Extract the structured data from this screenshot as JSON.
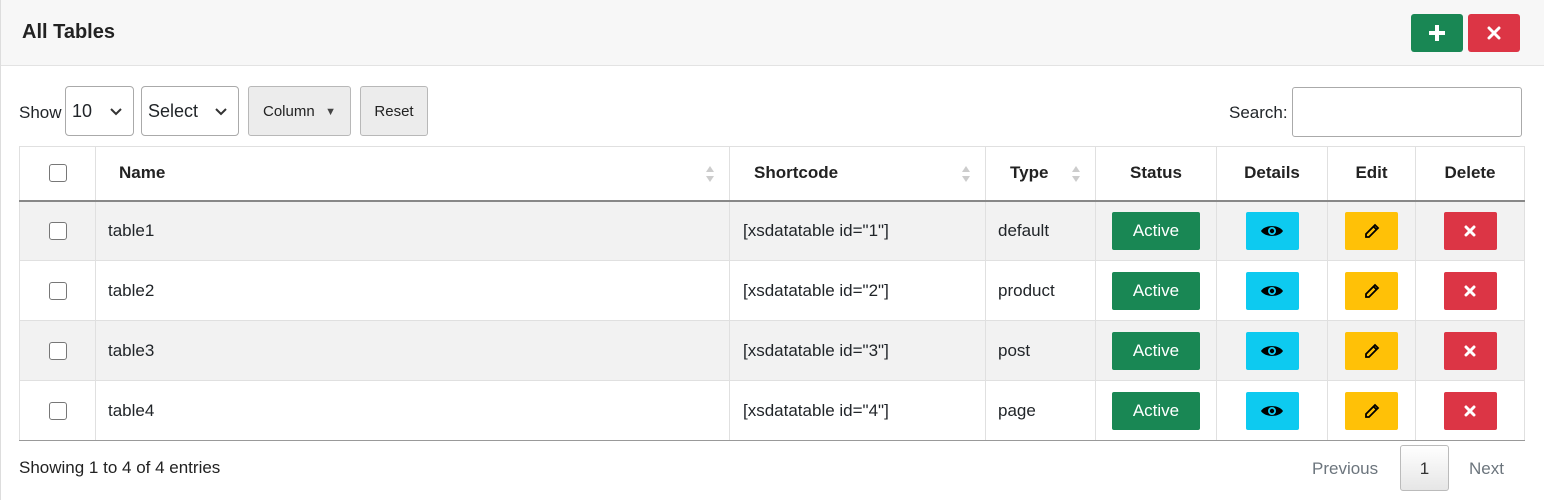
{
  "header": {
    "title": "All Tables",
    "add_icon": "plus-icon",
    "close_icon": "close-icon",
    "colors": {
      "add": "#198754",
      "close": "#dc3545"
    }
  },
  "controls": {
    "show_label": "Show",
    "page_length": "10",
    "bulk_select": "Select",
    "column_button": "Column",
    "reset_button": "Reset",
    "search_label": "Search:",
    "search_value": ""
  },
  "table": {
    "columns": [
      "",
      "Name",
      "Shortcode",
      "Type",
      "Status",
      "Details",
      "Edit",
      "Delete"
    ],
    "rows": [
      {
        "name": "table1",
        "shortcode": "[xsdatatable id=\"1\"]",
        "type": "default",
        "status": "Active"
      },
      {
        "name": "table2",
        "shortcode": "[xsdatatable id=\"2\"]",
        "type": "product",
        "status": "Active"
      },
      {
        "name": "table3",
        "shortcode": "[xsdatatable id=\"3\"]",
        "type": "post",
        "status": "Active"
      },
      {
        "name": "table4",
        "shortcode": "[xsdatatable id=\"4\"]",
        "type": "page",
        "status": "Active"
      }
    ],
    "icons": {
      "details": "eye-icon",
      "edit": "pencil-icon",
      "delete": "close-icon"
    },
    "colors": {
      "active": "#198754",
      "details": "#0dcaf0",
      "edit": "#ffc107",
      "delete": "#dc3545"
    }
  },
  "footer": {
    "info": "Showing 1 to 4 of 4 entries",
    "previous": "Previous",
    "current_page": "1",
    "next": "Next"
  }
}
